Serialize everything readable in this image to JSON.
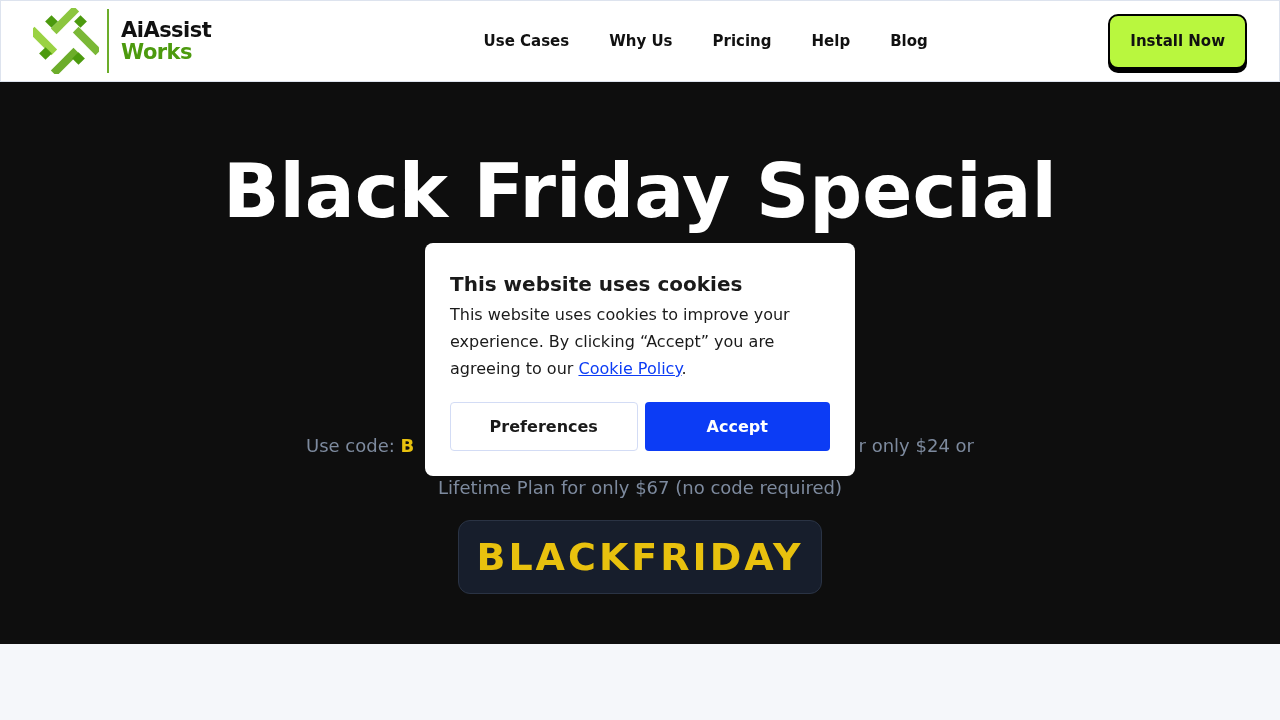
{
  "header": {
    "logo": {
      "line_1": "AiAssist",
      "line_2": "Works"
    },
    "nav": [
      "Use Cases",
      "Why Us",
      "Pricing",
      "Help",
      "Blog"
    ],
    "cta": "Install Now"
  },
  "hero": {
    "title": "Black Friday Special",
    "offer_left": "Use code: **B**",
    "offer_right": "r only $24 or",
    "offer_line_2": "Lifetime Plan for only $67 (no code required)",
    "code": "BLACKFRIDAY"
  },
  "cookie_dialog": {
    "title": "This website uses cookies",
    "body": "This website uses cookies to improve your experience. By clicking “Accept” you are agreeing to our ",
    "link": "Cookie Policy",
    "body_end": ".",
    "buttons": [
      {
        "label": "Preferences",
        "kind": "secondary"
      },
      {
        "label": "Accept",
        "kind": "primary"
      }
    ]
  }
}
